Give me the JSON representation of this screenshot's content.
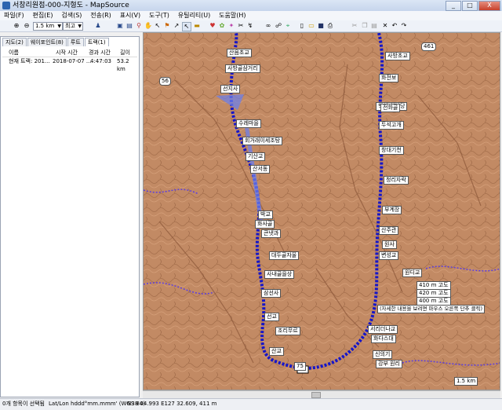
{
  "window": {
    "title": "서창리원점-000-지형도 - MapSource",
    "minimize": "_",
    "maximize": "□",
    "close": "X"
  },
  "menu": [
    "파일(F)",
    "편집(E)",
    "검색(S)",
    "전송(R)",
    "표시(V)",
    "도구(T)",
    "유틸리티(U)",
    "도움말(H)"
  ],
  "toolbar": {
    "scale_value": "1.5 km",
    "detail_value": "최고"
  },
  "tabs": [
    "지도(2)",
    "웨이포인트(8)",
    "루트",
    "트랙(1)"
  ],
  "track_list": {
    "headers": [
      "이름",
      "시작 시간",
      "경과 시간",
      "길이"
    ],
    "rows": [
      {
        "name": "현재 트랙: 201...",
        "start": "2018-07-07 ...",
        "elapsed": "4:47:03",
        "length": "53.2 km"
      }
    ]
  },
  "map": {
    "waypoint_labels": [
      "산음초교",
      "사방골삼거리",
      "선지사",
      "사방초교",
      "화전보",
      "학성 청봉당",
      "전화골",
      "두석고개",
      "창대기천",
      "수레마을",
      "회거래이세조탕",
      "기산교",
      "산서동",
      "청리자락",
      "박교",
      "화사골",
      "큰냇과",
      "부계장",
      "산주관",
      "변성교",
      "대두골자울",
      "사내골을상",
      "삼선사",
      "선교",
      "조리무르",
      "서리더나교",
      "화다스대",
      "신의기",
      "강부 원리",
      "원사",
      "산교",
      "원디교"
    ],
    "route_numbers": [
      "56",
      "461",
      "75"
    ],
    "info_box": [
      "410 m 고도",
      "420 m 고도",
      "400 m 고도"
    ],
    "tooltip": "(자세한 내용을 보려면 마우스 오른쪽 단추 클릭)",
    "scale_bar": "1.5 km"
  },
  "status": {
    "selection": "0개 항목이 선택됨",
    "format": "Lat/Lon hddd°mm.mmm' (WGS 84)",
    "coords": "N38 04.993 E127 32.609, 411 m"
  }
}
